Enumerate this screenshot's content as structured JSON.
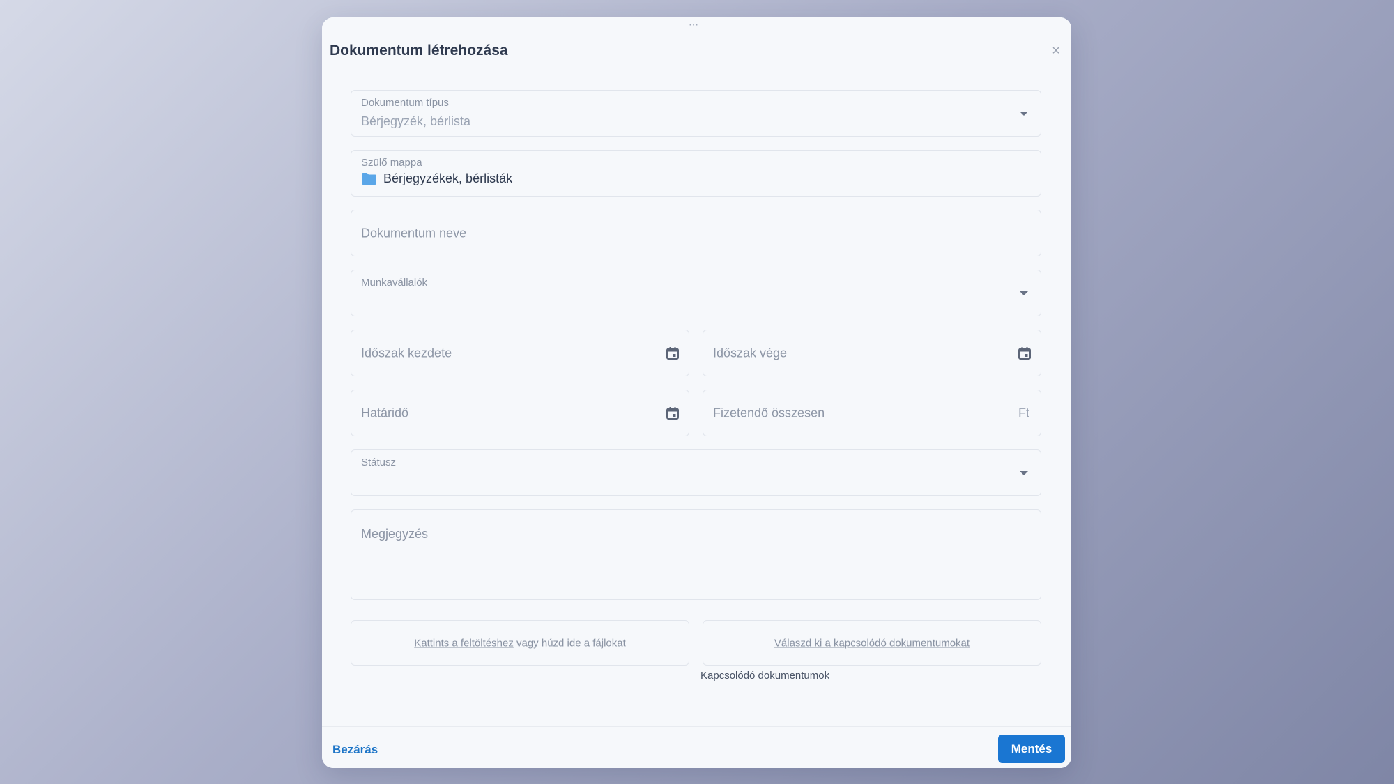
{
  "modal": {
    "drag_handle": "⋯",
    "title": "Dokumentum létrehozása",
    "close_icon": "×"
  },
  "form": {
    "document_type": {
      "label": "Dokumentum típus",
      "value": "Bérjegyzék, bérlista"
    },
    "parent_folder": {
      "label": "Szülő mappa",
      "value": "Bérjegyzékek, bérlisták",
      "icon": "folder-icon",
      "icon_color": "#5aa6e8"
    },
    "document_name": {
      "placeholder": "Dokumentum neve"
    },
    "employees": {
      "label": "Munkavállalók"
    },
    "period_start": {
      "placeholder": "Időszak kezdete"
    },
    "period_end": {
      "placeholder": "Időszak vége"
    },
    "deadline": {
      "placeholder": "Határidő"
    },
    "total_payable": {
      "placeholder": "Fizetendő összesen",
      "suffix": "Ft"
    },
    "status": {
      "label": "Státusz"
    },
    "note": {
      "placeholder": "Megjegyzés"
    },
    "upload": {
      "link_text": "Kattints a feltöltéshez",
      "rest_text": " vagy húzd ide a fájlokat"
    },
    "related": {
      "link_text": "Válaszd ki a kapcsolódó dokumentumokat",
      "label": "Kapcsolódó dokumentumok"
    }
  },
  "footer": {
    "close_label": "Bezárás",
    "save_label": "Mentés"
  },
  "colors": {
    "accent": "#1a76d2",
    "folder": "#5aa6e8"
  }
}
